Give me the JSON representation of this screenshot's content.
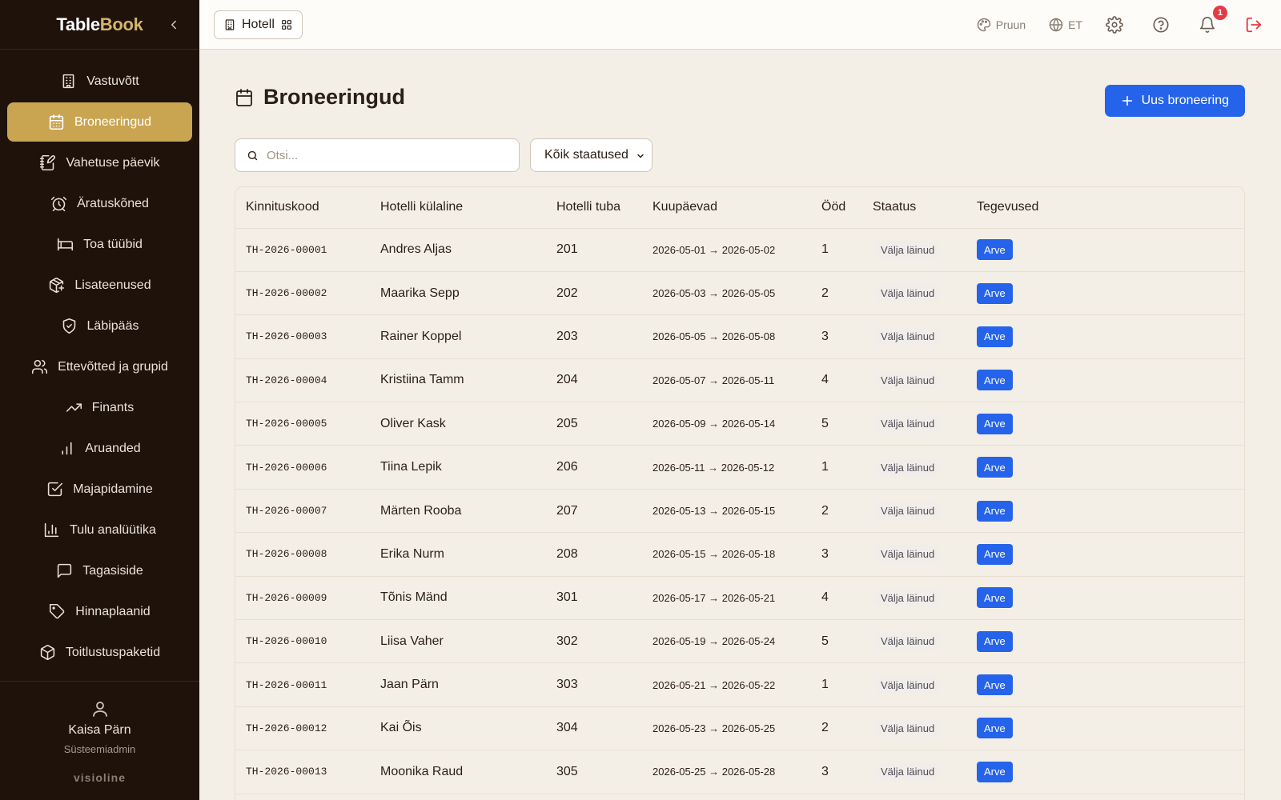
{
  "brand": {
    "name_part1": "Table",
    "name_part2": "Book",
    "footer": "visioline"
  },
  "sidebar": {
    "items": [
      {
        "label": "Vastuvõtt",
        "icon": "building-icon",
        "active": false
      },
      {
        "label": "Broneeringud",
        "icon": "calendar-icon",
        "active": true
      },
      {
        "label": "Vahetuse päevik",
        "icon": "notebook-pen-icon",
        "active": false
      },
      {
        "label": "Äratuskõned",
        "icon": "alarm-clock-icon",
        "active": false
      },
      {
        "label": "Toa tüübid",
        "icon": "bed-icon",
        "active": false
      },
      {
        "label": "Lisateenused",
        "icon": "package-plus-icon",
        "active": false
      },
      {
        "label": "Läbipääs",
        "icon": "shield-check-icon",
        "active": false
      },
      {
        "label": "Ettevõtted ja grupid",
        "icon": "users-icon",
        "active": false
      },
      {
        "label": "Finants",
        "icon": "trending-up-icon",
        "active": false
      },
      {
        "label": "Aruanded",
        "icon": "bar-chart-icon",
        "active": false
      },
      {
        "label": "Majapidamine",
        "icon": "check-square-icon",
        "active": false
      },
      {
        "label": "Tulu analüütika",
        "icon": "chart-columns-icon",
        "active": false
      },
      {
        "label": "Tagasiside",
        "icon": "message-square-icon",
        "active": false
      },
      {
        "label": "Hinnaplaanid",
        "icon": "tag-icon",
        "active": false
      },
      {
        "label": "Toitlustuspaketid",
        "icon": "box-icon",
        "active": false
      }
    ]
  },
  "user": {
    "name": "Kaisa Pärn",
    "role": "Süsteemiadmin"
  },
  "topbar": {
    "module_label": "Hotell",
    "theme_label": "Pruun",
    "language_label": "ET",
    "notification_count": "1"
  },
  "page": {
    "title": "Broneeringud",
    "new_button_label": "Uus broneering",
    "search_placeholder": "Otsi...",
    "status_filter_value": "Kõik staatused"
  },
  "table": {
    "columns": [
      "Kinnituskood",
      "Hotelli külaline",
      "Hotelli tuba",
      "Kuupäevad",
      "Ööd",
      "Staatus",
      "Tegevused"
    ],
    "rows": [
      {
        "code": "TH-2026-00001",
        "guest": "Andres Aljas",
        "room": "201",
        "dates": "2026-05-01 → 2026-05-02",
        "nights": "1",
        "status": "Välja läinud",
        "action": "Arve"
      },
      {
        "code": "TH-2026-00002",
        "guest": "Maarika Sepp",
        "room": "202",
        "dates": "2026-05-03 → 2026-05-05",
        "nights": "2",
        "status": "Välja läinud",
        "action": "Arve"
      },
      {
        "code": "TH-2026-00003",
        "guest": "Rainer Koppel",
        "room": "203",
        "dates": "2026-05-05 → 2026-05-08",
        "nights": "3",
        "status": "Välja läinud",
        "action": "Arve"
      },
      {
        "code": "TH-2026-00004",
        "guest": "Kristiina Tamm",
        "room": "204",
        "dates": "2026-05-07 → 2026-05-11",
        "nights": "4",
        "status": "Välja läinud",
        "action": "Arve"
      },
      {
        "code": "TH-2026-00005",
        "guest": "Oliver Kask",
        "room": "205",
        "dates": "2026-05-09 → 2026-05-14",
        "nights": "5",
        "status": "Välja läinud",
        "action": "Arve"
      },
      {
        "code": "TH-2026-00006",
        "guest": "Tiina Lepik",
        "room": "206",
        "dates": "2026-05-11 → 2026-05-12",
        "nights": "1",
        "status": "Välja läinud",
        "action": "Arve"
      },
      {
        "code": "TH-2026-00007",
        "guest": "Märten Rooba",
        "room": "207",
        "dates": "2026-05-13 → 2026-05-15",
        "nights": "2",
        "status": "Välja läinud",
        "action": "Arve"
      },
      {
        "code": "TH-2026-00008",
        "guest": "Erika Nurm",
        "room": "208",
        "dates": "2026-05-15 → 2026-05-18",
        "nights": "3",
        "status": "Välja läinud",
        "action": "Arve"
      },
      {
        "code": "TH-2026-00009",
        "guest": "Tõnis Mänd",
        "room": "301",
        "dates": "2026-05-17 → 2026-05-21",
        "nights": "4",
        "status": "Välja läinud",
        "action": "Arve"
      },
      {
        "code": "TH-2026-00010",
        "guest": "Liisa Vaher",
        "room": "302",
        "dates": "2026-05-19 → 2026-05-24",
        "nights": "5",
        "status": "Välja läinud",
        "action": "Arve"
      },
      {
        "code": "TH-2026-00011",
        "guest": "Jaan Pärn",
        "room": "303",
        "dates": "2026-05-21 → 2026-05-22",
        "nights": "1",
        "status": "Välja läinud",
        "action": "Arve"
      },
      {
        "code": "TH-2026-00012",
        "guest": "Kai Õis",
        "room": "304",
        "dates": "2026-05-23 → 2026-05-25",
        "nights": "2",
        "status": "Välja läinud",
        "action": "Arve"
      },
      {
        "code": "TH-2026-00013",
        "guest": "Moonika Raud",
        "room": "305",
        "dates": "2026-05-25 → 2026-05-28",
        "nights": "3",
        "status": "Välja läinud",
        "action": "Arve"
      }
    ]
  },
  "colors": {
    "sidebar_bg": "#1e120b",
    "active_nav": "#c9a552",
    "primary_button": "#2563eb",
    "page_bg": "#f4efe6",
    "badge_red": "#e63946"
  }
}
